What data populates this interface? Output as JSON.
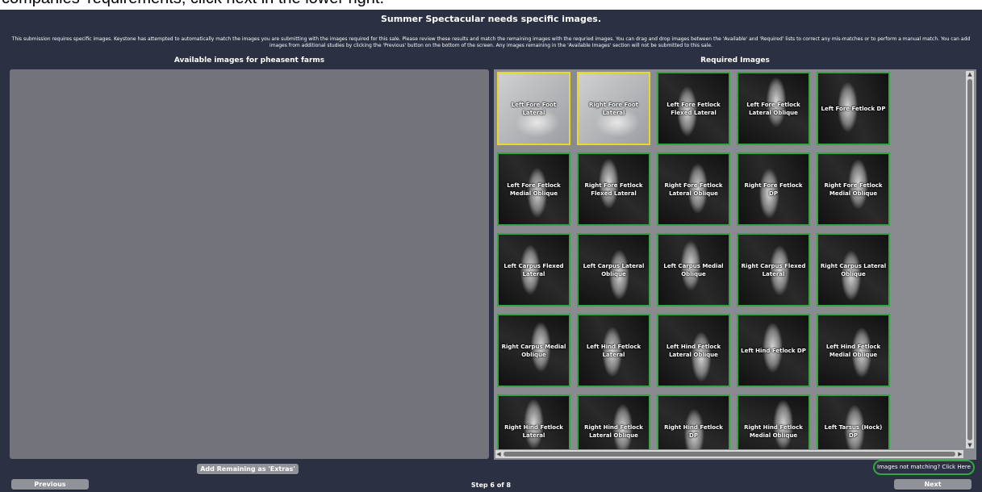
{
  "banner_text": "companies' requirements, click next in the lower right.",
  "title": "Summer Spectacular needs specific images.",
  "intro": "This submission requires specific images. Keystone has attempted to automatically match the images you are submitting with the images required for this sale. Please review these results and match the remaining images with the requried images. You can drag and drop images between the 'Available' and 'Required' lists to correct any mis-matches or to perform a manual match. You can add images from additional studies by clicking the 'Previous' button on the bottom of the screen. Any images remaining in the 'Available Images' section will not be submitted to this sale.",
  "available_header": "Available images for pheasent farms",
  "required_header": "Required Images",
  "required_images": [
    {
      "label": "Left Fore Foot Lateral",
      "status": "yellow"
    },
    {
      "label": "Right Fore Foot Lateral",
      "status": "yellow"
    },
    {
      "label": "Left Fore Fetlock Flexed Lateral",
      "status": "green"
    },
    {
      "label": "Left Fore Fetlock Lateral Oblique",
      "status": "green"
    },
    {
      "label": "Left Fore Fetlock DP",
      "status": "green"
    },
    {
      "label": "Left Fore Fetlock Medial Oblique",
      "status": "green"
    },
    {
      "label": "Right Fore Fetlock Flexed Lateral",
      "status": "green"
    },
    {
      "label": "Right Fore Fetlock Lateral Oblique",
      "status": "green"
    },
    {
      "label": "Right Fore Fetlock DP",
      "status": "green"
    },
    {
      "label": "Right Fore Fetlock Medial Oblique",
      "status": "green"
    },
    {
      "label": "Left Carpus Flexed Lateral",
      "status": "green"
    },
    {
      "label": "Left Carpus Lateral Oblique",
      "status": "green"
    },
    {
      "label": "Left Carpus Medial Oblique",
      "status": "green"
    },
    {
      "label": "Right Carpus Flexed Lateral",
      "status": "green"
    },
    {
      "label": "Right Carpus Lateral Oblique",
      "status": "green"
    },
    {
      "label": "Right Carpus Medial Oblique",
      "status": "green"
    },
    {
      "label": "Left Hind Fetlock Lateral",
      "status": "green"
    },
    {
      "label": "Left Hind Fetlock Lateral Oblique",
      "status": "green"
    },
    {
      "label": "Left Hind Fetlock DP",
      "status": "green"
    },
    {
      "label": "Left Hind Fetlock Medial Oblique",
      "status": "green"
    },
    {
      "label": "Right Hind Fetlock Lateral",
      "status": "green"
    },
    {
      "label": "Right Hind Fetlock Lateral Oblique",
      "status": "green"
    },
    {
      "label": "Right Hind Fetlock DP",
      "status": "green"
    },
    {
      "label": "Right Hind Fetlock Medial Oblique",
      "status": "green"
    },
    {
      "label": "Left Tarsus (Hock) DP",
      "status": "green"
    }
  ],
  "add_remaining_label": "Add Remaining as 'Extras'",
  "not_matching_label": "Images not matching? Click Here",
  "previous_label": "Previous",
  "next_label": "Next",
  "step_text": "Step 6 of 8",
  "colors": {
    "background": "#2b3042",
    "matched_border": "#35a542",
    "highlight_border": "#e9d82a"
  }
}
